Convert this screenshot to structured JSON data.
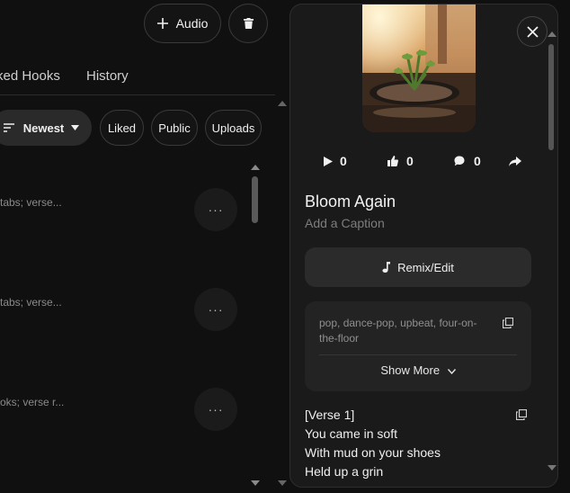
{
  "toolbar": {
    "audio_label": "Audio",
    "add_icon": "plus-icon",
    "delete_icon": "trash-icon"
  },
  "tabs": [
    {
      "label": "ked Hooks"
    },
    {
      "label": "History"
    }
  ],
  "filters": {
    "sort_label": "Newest",
    "items": [
      "Liked",
      "Public",
      "Uploads"
    ]
  },
  "list": [
    {
      "text": "tabs; verse..."
    },
    {
      "text": "tabs; verse..."
    },
    {
      "text": "oks; verse r..."
    }
  ],
  "more_glyph": "···",
  "detail": {
    "stats": {
      "plays": "0",
      "likes": "0",
      "comments": "0"
    },
    "title": "Bloom Again",
    "caption_placeholder": "Add a Caption",
    "remix_label": "Remix/Edit",
    "tags": "pop, dance-pop, upbeat, four-on-the-floor",
    "show_more_label": "Show More",
    "lyrics": [
      "[Verse 1]",
      "You came in soft",
      "With mud on your shoes",
      "Held up a grin"
    ]
  },
  "colors": {
    "background": "#101010",
    "panel": "#1a1a1a",
    "accent_button": "#2b2b2b"
  }
}
